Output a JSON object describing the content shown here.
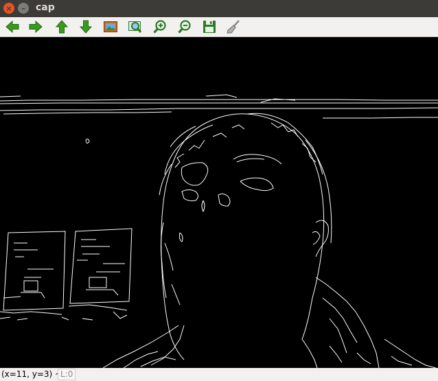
{
  "window": {
    "title": "cap",
    "close_glyph": "×",
    "minimize_glyph": "–"
  },
  "toolbar": {
    "buttons": [
      {
        "name": "pan-left-button",
        "icon": "arrow-left-icon",
        "color": "#3a9a1e"
      },
      {
        "name": "pan-right-button",
        "icon": "arrow-right-icon",
        "color": "#3a9a1e"
      },
      {
        "name": "pan-up-button",
        "icon": "arrow-up-icon",
        "color": "#3a9a1e"
      },
      {
        "name": "pan-down-button",
        "icon": "arrow-down-icon",
        "color": "#3a9a1e"
      },
      {
        "name": "zoom-fit-button",
        "icon": "image-icon",
        "color": "#c46b1d"
      },
      {
        "name": "zoom-original-button",
        "icon": "zoom-image-icon",
        "color": "#2a7a28"
      },
      {
        "name": "zoom-in-button",
        "icon": "zoom-in-icon",
        "color": "#2a7a28"
      },
      {
        "name": "zoom-out-button",
        "icon": "zoom-out-icon",
        "color": "#2a7a28"
      },
      {
        "name": "save-button",
        "icon": "floppy-disk-icon",
        "color": "#2a7a28"
      },
      {
        "name": "properties-button",
        "icon": "brush-icon",
        "color": "#9a9a9a"
      }
    ]
  },
  "status": {
    "coords": "(x=11, y=3) ~",
    "level": "L:0"
  }
}
